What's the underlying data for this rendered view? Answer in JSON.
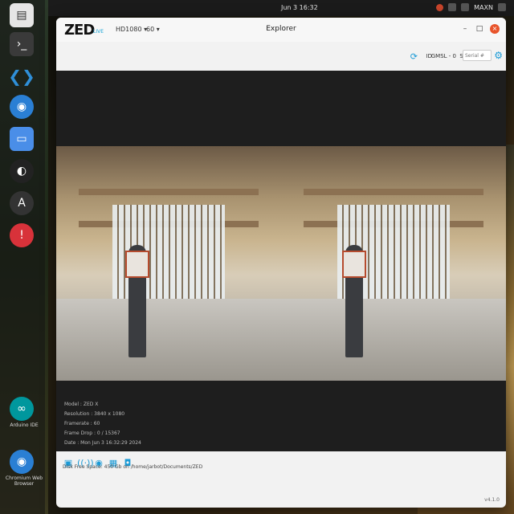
{
  "topbar": {
    "clock": "Jun 3  16:32",
    "user": "MAXN"
  },
  "dock": {
    "items": [
      {
        "label": "",
        "icon": "folder-icon"
      },
      {
        "label": "",
        "icon": "terminal-icon"
      },
      {
        "label": "",
        "icon": "vscode-icon"
      },
      {
        "label": "",
        "icon": "chromium-icon"
      },
      {
        "label": "",
        "icon": "window-icon"
      },
      {
        "label": "",
        "icon": "obs-icon"
      },
      {
        "label": "",
        "icon": "assistant-icon"
      },
      {
        "label": "",
        "icon": "alert-icon"
      },
      {
        "label": "Arduino IDE",
        "icon": "arduino-icon"
      },
      {
        "label": "Chromium Web Browser",
        "icon": "chromium-icon"
      }
    ]
  },
  "window": {
    "title": "Explorer",
    "logo": "ZED",
    "logo_sub": "LIVE",
    "resolution": "HD1080",
    "fps": "60",
    "id_label": "ID",
    "port": "GMSL - 0",
    "sn_label": "SN",
    "sn_placeholder": "Serial #"
  },
  "info": {
    "model": "Model : ZED X",
    "resolution": "Resolution : 3840 x 1080",
    "framerate": "Framerate : 60",
    "frame_drop": "Frame Drop : 0 / 15367",
    "date": "Date : Mon Jun 3 16:32:29 2024"
  },
  "status": {
    "disk": "Disk Free Space: 450 Gb  on  /home/jarbot/Documents/ZED",
    "version": "v4.1.0"
  },
  "colors": {
    "accent": "#1a9ad6",
    "close": "#e8542b"
  }
}
